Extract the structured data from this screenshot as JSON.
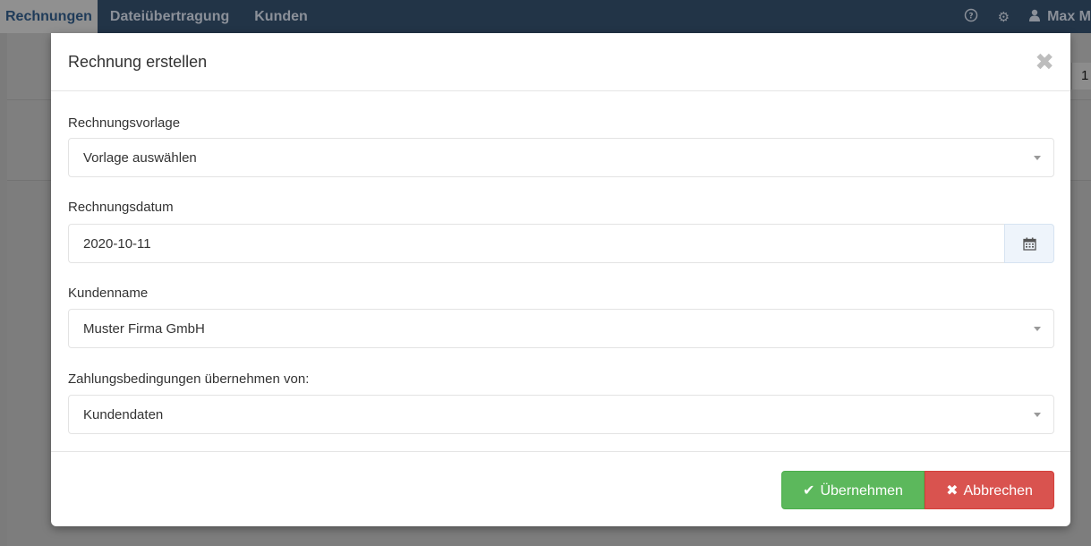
{
  "nav": {
    "items": [
      "Rechnungen",
      "Dateiübertragung",
      "Kunden"
    ],
    "help_icon": "?",
    "settings_icon": "⚙",
    "user_icon": "👤",
    "user_name": "Max M",
    "bg_count": "1"
  },
  "modal": {
    "title": "Rechnung erstellen",
    "close_symbol": "✖",
    "template": {
      "label": "Rechnungsvorlage",
      "value": "Vorlage auswählen"
    },
    "date": {
      "label": "Rechnungsdatum",
      "value": "2020-10-11"
    },
    "customer": {
      "label": "Kundenname",
      "value": "Muster Firma GmbH"
    },
    "payment_terms": {
      "label": "Zahlungsbedingungen übernehmen von:",
      "value": "Kundendaten"
    },
    "ok_icon": "✔",
    "ok_label": "Übernehmen",
    "cancel_icon": "✖",
    "cancel_label": "Abbrechen"
  },
  "colors": {
    "navbar": "#223447",
    "success": "#5cb85c",
    "danger": "#d9534f"
  }
}
